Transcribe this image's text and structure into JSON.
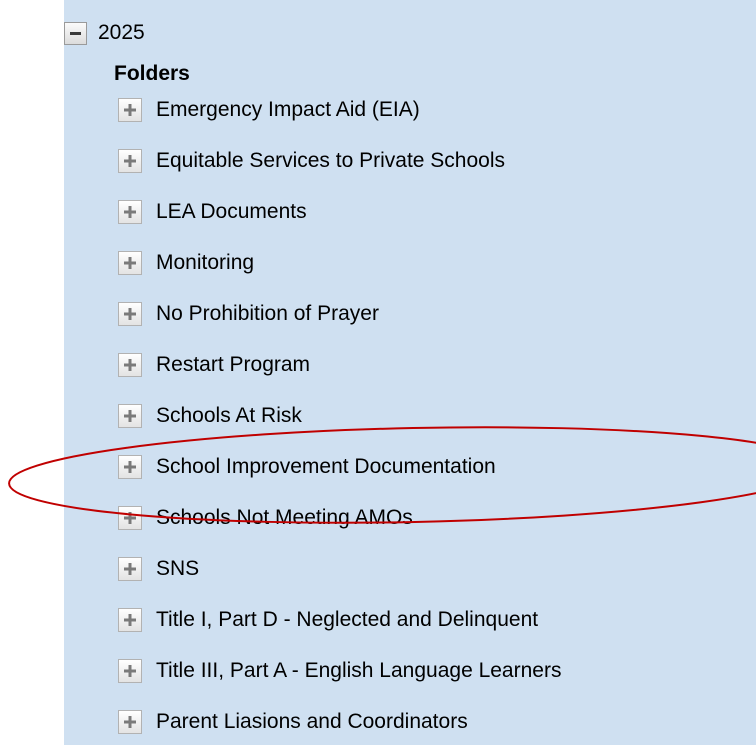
{
  "tree": {
    "root": {
      "label": "2025",
      "expander_icon": "minus-icon"
    },
    "section_title": "Folders",
    "folders": [
      {
        "label": "Emergency Impact Aid (EIA)",
        "expander_icon": "plus-icon"
      },
      {
        "label": "Equitable Services to Private Schools",
        "expander_icon": "plus-icon"
      },
      {
        "label": "LEA Documents",
        "expander_icon": "plus-icon"
      },
      {
        "label": "Monitoring",
        "expander_icon": "plus-icon"
      },
      {
        "label": "No Prohibition of Prayer",
        "expander_icon": "plus-icon"
      },
      {
        "label": "Restart Program",
        "expander_icon": "plus-icon"
      },
      {
        "label": "Schools At Risk",
        "expander_icon": "plus-icon"
      },
      {
        "label": "School Improvement Documentation",
        "expander_icon": "plus-icon"
      },
      {
        "label": "Schools Not Meeting AMOs",
        "expander_icon": "plus-icon"
      },
      {
        "label": "SNS",
        "expander_icon": "plus-icon"
      },
      {
        "label": "Title I, Part D - Neglected and Delinquent",
        "expander_icon": "plus-icon"
      },
      {
        "label": "Title III, Part A - English Language Learners",
        "expander_icon": "plus-icon"
      },
      {
        "label": "Parent Liasions and Coordinators",
        "expander_icon": "plus-icon"
      }
    ]
  },
  "annotation": {
    "highlighted_folder": "School Improvement Documentation",
    "color": "#c00000"
  },
  "colors": {
    "panel_background": "#cfe0f1",
    "page_background": "#ffffff"
  }
}
